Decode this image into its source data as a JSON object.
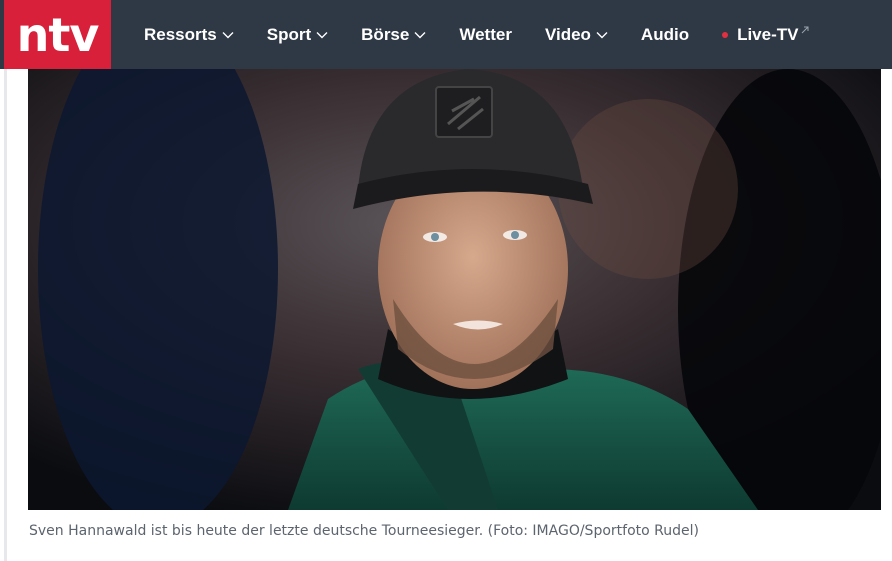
{
  "brand": {
    "logo_text": "ntv",
    "color": "#d9203a"
  },
  "nav": {
    "background": "#2f3845",
    "items": [
      {
        "label": "Ressorts",
        "has_dropdown": true
      },
      {
        "label": "Sport",
        "has_dropdown": true
      },
      {
        "label": "Börse",
        "has_dropdown": true
      },
      {
        "label": "Wetter",
        "has_dropdown": false
      },
      {
        "label": "Video",
        "has_dropdown": true
      },
      {
        "label": "Audio",
        "has_dropdown": false
      }
    ],
    "live": {
      "label": "Live-TV",
      "dot_color": "#e33040",
      "icon": "external-link-icon"
    }
  },
  "article": {
    "image": {
      "subject": "man-in-black-cap-and-green-jacket"
    },
    "caption": "Sven Hannawald ist bis heute der letzte deutsche Tourneesieger. (Foto: IMAGO/Sportfoto Rudel)"
  }
}
